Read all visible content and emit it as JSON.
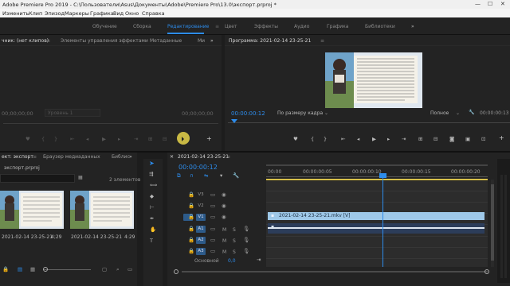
{
  "window": {
    "title": "Adobe Premiere Pro 2019 - C:\\Пользователи\\Asus\\Документы\\Adobe\\Premiere Pro\\13.0\\экспорт.prproj *"
  },
  "menu": [
    "Изменить",
    "Клип",
    "Эпизод",
    "Маркеры",
    "Графика",
    "Вид",
    "Окно",
    "Справка"
  ],
  "workspaces": {
    "items": [
      "Обучение",
      "Сборка",
      "Редактирование",
      "Цвет",
      "Эффекты",
      "Аудио",
      "Графика",
      "Библиотеки"
    ],
    "active": "Редактирование"
  },
  "source_panel": {
    "tabs": [
      "чник: (нет клипов)",
      "Элементы управления эффектами",
      "Метаданные",
      "Ми"
    ],
    "timecode_left": "00;00;00;00",
    "timecode_right": "00;00;00;00",
    "zoom_label": "Уровень 1"
  },
  "program_monitor": {
    "tab": "Программа: 2021-02-14 23-25-21",
    "timecode": "00:00:00:12",
    "fit": "По размеру кадра",
    "quality": "Полное",
    "duration": "00:00:00:13"
  },
  "project_panel": {
    "tabs": [
      "ект: экспорт",
      "Браузер медиаданных",
      "Библис"
    ],
    "project_file": "экспорт.prproj",
    "item_count": "2 элементов",
    "items": [
      {
        "name": "2021-02-14 23-25-21",
        "duration": "4;29"
      },
      {
        "name": "2021-02-14 23-25-21",
        "duration": "4:29"
      }
    ]
  },
  "timeline": {
    "tab": "2021-02-14 23-25-21",
    "timecode": "00:00:00:12",
    "ruler": [
      "00:00",
      "00:00:00:05",
      "00:00:00:10",
      "00:00:00:15",
      "00:00:00:20"
    ],
    "tracks_video": [
      "V3",
      "V2",
      "V1"
    ],
    "tracks_audio": [
      "A1",
      "A2",
      "A3"
    ],
    "master": "Основной",
    "master_value": "0,0",
    "video_clip_label": "2021-02-14 23-25-21.mkv [V]",
    "audio_letters": {
      "mute": "M",
      "solo": "S"
    },
    "playhead_fraction": 0.53
  },
  "colors": {
    "accent": "#2d8ceb",
    "video_clip": "#9ec8e8",
    "audio_clip": "#2c3d5a"
  }
}
